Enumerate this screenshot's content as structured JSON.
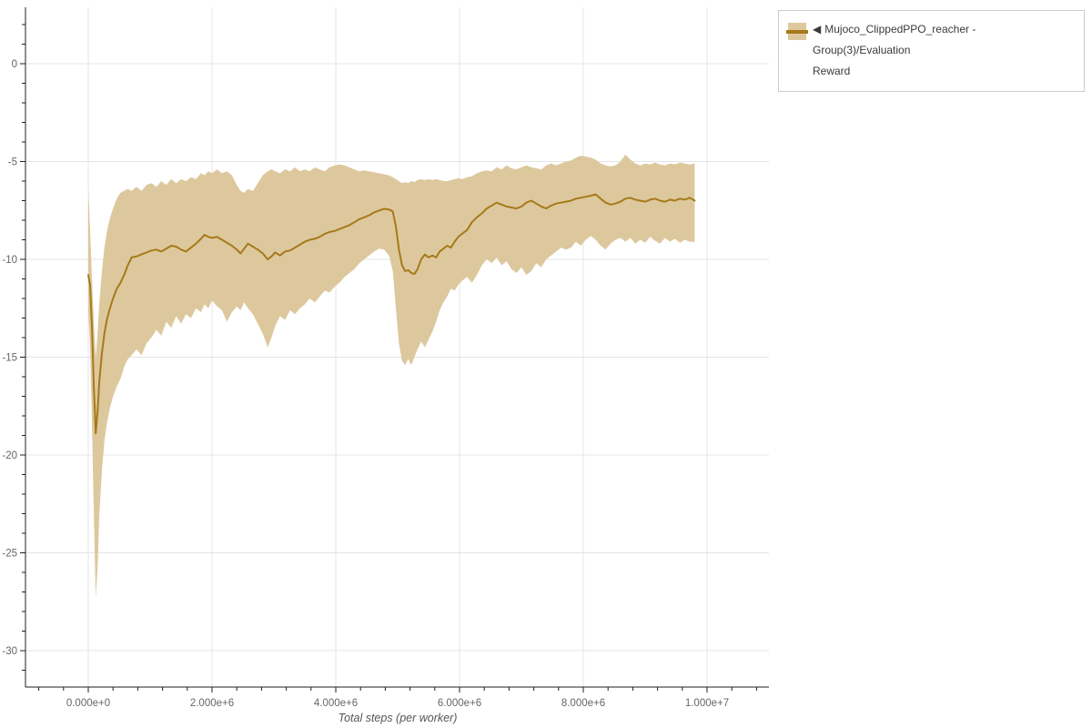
{
  "legend": {
    "marker": "◀",
    "label_line1": "Mujoco_ClippedPPO_reacher - Group(3)/Evaluation",
    "label_line2": "Reward",
    "border_color": "#cccccc",
    "text_color": "#3a3a3a"
  },
  "chart_data": {
    "type": "line",
    "title": "",
    "xlabel": "Total steps (per worker)",
    "ylabel": "",
    "grid": true,
    "legend_position": "top-right",
    "xlim_steps": [
      -1000000,
      11000000
    ],
    "ylim": [
      -31.9,
      2.9
    ],
    "colors": {
      "grid": "#e4e4e4",
      "axis": "#1f1f1f",
      "tick_label": "#666666",
      "axis_title": "#555555"
    },
    "x_axis": {
      "label": "Total steps (per worker)",
      "ticks": [
        {
          "value_millions": 0,
          "label": "0.000e+0"
        },
        {
          "value_millions": 2,
          "label": "2.000e+6"
        },
        {
          "value_millions": 4,
          "label": "4.000e+6"
        },
        {
          "value_millions": 6,
          "label": "6.000e+6"
        },
        {
          "value_millions": 8,
          "label": "8.000e+6"
        },
        {
          "value_millions": 10,
          "label": "1.000e+7"
        }
      ],
      "minor": {
        "from": -0.8,
        "to": 10.8,
        "step": 0.4
      }
    },
    "y_axis": {
      "ticks": [
        {
          "value": 0,
          "label": "0"
        },
        {
          "value": -5,
          "label": "-5"
        },
        {
          "value": -10,
          "label": "-10"
        },
        {
          "value": -15,
          "label": "-15"
        },
        {
          "value": -20,
          "label": "-20"
        },
        {
          "value": -25,
          "label": "-25"
        },
        {
          "value": -30,
          "label": "-30"
        }
      ],
      "minor": {
        "from": 2,
        "to": -31,
        "step": -1
      }
    },
    "series": [
      {
        "name": "Mujoco_ClippedPPO_reacher - Group(3)/Evaluation Reward",
        "line_color": "#a57a18",
        "band_color": "#ddc89e",
        "points_format": [
          "x_steps_millions",
          "mean",
          "band_lower",
          "band_upper"
        ],
        "points": [
          [
            0.0,
            -10.8,
            -12.6,
            -6.3
          ],
          [
            0.03,
            -11.3,
            -14.5,
            -8.5
          ],
          [
            0.06,
            -13.5,
            -18.5,
            -11.0
          ],
          [
            0.09,
            -16.5,
            -23.0,
            -13.2
          ],
          [
            0.12,
            -18.9,
            -27.3,
            -15.0
          ],
          [
            0.15,
            -17.8,
            -25.8,
            -13.8
          ],
          [
            0.18,
            -16.2,
            -23.0,
            -12.2
          ],
          [
            0.22,
            -14.8,
            -20.8,
            -10.6
          ],
          [
            0.26,
            -13.8,
            -19.3,
            -9.4
          ],
          [
            0.3,
            -13.1,
            -18.4,
            -8.6
          ],
          [
            0.35,
            -12.5,
            -17.6,
            -7.9
          ],
          [
            0.4,
            -12.0,
            -17.0,
            -7.4
          ],
          [
            0.46,
            -11.5,
            -16.5,
            -6.9
          ],
          [
            0.52,
            -11.2,
            -16.1,
            -6.6
          ],
          [
            0.58,
            -10.8,
            -15.5,
            -6.5
          ],
          [
            0.64,
            -10.3,
            -15.1,
            -6.4
          ],
          [
            0.7,
            -9.9,
            -14.9,
            -6.5
          ],
          [
            0.78,
            -9.85,
            -14.6,
            -6.3
          ],
          [
            0.86,
            -9.75,
            -14.9,
            -6.5
          ],
          [
            0.94,
            -9.65,
            -14.3,
            -6.2
          ],
          [
            1.02,
            -9.55,
            -14.0,
            -6.1
          ],
          [
            1.1,
            -9.5,
            -13.6,
            -6.3
          ],
          [
            1.18,
            -9.6,
            -13.9,
            -6.0
          ],
          [
            1.26,
            -9.45,
            -13.2,
            -6.2
          ],
          [
            1.34,
            -9.3,
            -13.5,
            -5.9
          ],
          [
            1.42,
            -9.35,
            -12.9,
            -6.1
          ],
          [
            1.5,
            -9.5,
            -13.3,
            -5.9
          ],
          [
            1.58,
            -9.6,
            -12.8,
            -6.0
          ],
          [
            1.66,
            -9.4,
            -13.0,
            -5.8
          ],
          [
            1.74,
            -9.2,
            -12.5,
            -5.9
          ],
          [
            1.82,
            -8.95,
            -12.7,
            -5.6
          ],
          [
            1.88,
            -8.75,
            -12.3,
            -5.7
          ],
          [
            1.94,
            -8.85,
            -12.5,
            -5.5
          ],
          [
            2.0,
            -8.9,
            -12.1,
            -5.6
          ],
          [
            2.08,
            -8.85,
            -12.4,
            -5.4
          ],
          [
            2.16,
            -9.0,
            -12.6,
            -5.6
          ],
          [
            2.24,
            -9.15,
            -13.2,
            -5.5
          ],
          [
            2.32,
            -9.3,
            -12.7,
            -5.7
          ],
          [
            2.4,
            -9.5,
            -12.4,
            -6.2
          ],
          [
            2.46,
            -9.7,
            -12.6,
            -6.5
          ],
          [
            2.52,
            -9.45,
            -12.2,
            -6.6
          ],
          [
            2.58,
            -9.2,
            -12.5,
            -6.4
          ],
          [
            2.66,
            -9.35,
            -12.8,
            -6.5
          ],
          [
            2.74,
            -9.5,
            -13.3,
            -6.1
          ],
          [
            2.82,
            -9.7,
            -13.8,
            -5.7
          ],
          [
            2.9,
            -10.0,
            -14.5,
            -5.5
          ],
          [
            2.96,
            -9.85,
            -14.0,
            -5.4
          ],
          [
            3.02,
            -9.65,
            -13.4,
            -5.5
          ],
          [
            3.1,
            -9.8,
            -12.9,
            -5.6
          ],
          [
            3.18,
            -9.6,
            -13.1,
            -5.4
          ],
          [
            3.26,
            -9.55,
            -12.6,
            -5.5
          ],
          [
            3.34,
            -9.4,
            -12.8,
            -5.3
          ],
          [
            3.42,
            -9.25,
            -12.5,
            -5.5
          ],
          [
            3.5,
            -9.1,
            -12.3,
            -5.4
          ],
          [
            3.58,
            -9.0,
            -12.0,
            -5.5
          ],
          [
            3.66,
            -8.95,
            -12.2,
            -5.3
          ],
          [
            3.74,
            -8.85,
            -11.9,
            -5.4
          ],
          [
            3.82,
            -8.7,
            -11.6,
            -5.5
          ],
          [
            3.9,
            -8.6,
            -11.7,
            -5.3
          ],
          [
            3.98,
            -8.55,
            -11.4,
            -5.2
          ],
          [
            4.06,
            -8.45,
            -11.2,
            -5.15
          ],
          [
            4.14,
            -8.35,
            -10.9,
            -5.2
          ],
          [
            4.22,
            -8.25,
            -10.7,
            -5.3
          ],
          [
            4.3,
            -8.1,
            -10.5,
            -5.4
          ],
          [
            4.38,
            -7.95,
            -10.2,
            -5.5
          ],
          [
            4.46,
            -7.85,
            -10.0,
            -5.45
          ],
          [
            4.54,
            -7.75,
            -9.8,
            -5.5
          ],
          [
            4.62,
            -7.6,
            -9.6,
            -5.55
          ],
          [
            4.7,
            -7.5,
            -9.45,
            -5.6
          ],
          [
            4.78,
            -7.42,
            -9.5,
            -5.65
          ],
          [
            4.86,
            -7.45,
            -9.8,
            -5.7
          ],
          [
            4.92,
            -7.55,
            -10.6,
            -5.8
          ],
          [
            4.97,
            -8.3,
            -12.5,
            -5.9
          ],
          [
            5.02,
            -9.5,
            -14.3,
            -6.0
          ],
          [
            5.07,
            -10.3,
            -15.2,
            -6.1
          ],
          [
            5.12,
            -10.6,
            -15.4,
            -6.05
          ],
          [
            5.17,
            -10.55,
            -15.1,
            -6.1
          ],
          [
            5.22,
            -10.7,
            -15.4,
            -6.0
          ],
          [
            5.27,
            -10.75,
            -15.0,
            -6.05
          ],
          [
            5.32,
            -10.5,
            -14.6,
            -5.95
          ],
          [
            5.38,
            -10.0,
            -14.2,
            -5.9
          ],
          [
            5.44,
            -9.75,
            -14.5,
            -5.95
          ],
          [
            5.5,
            -9.9,
            -14.1,
            -5.9
          ],
          [
            5.56,
            -9.8,
            -13.7,
            -5.95
          ],
          [
            5.62,
            -9.9,
            -13.2,
            -5.9
          ],
          [
            5.68,
            -9.6,
            -12.6,
            -5.95
          ],
          [
            5.74,
            -9.45,
            -12.2,
            -6.0
          ],
          [
            5.8,
            -9.3,
            -11.9,
            -6.0
          ],
          [
            5.86,
            -9.4,
            -11.5,
            -5.95
          ],
          [
            5.92,
            -9.1,
            -11.6,
            -5.9
          ],
          [
            5.98,
            -8.85,
            -11.3,
            -5.85
          ],
          [
            6.04,
            -8.7,
            -11.1,
            -5.9
          ],
          [
            6.12,
            -8.5,
            -10.9,
            -5.8
          ],
          [
            6.2,
            -8.1,
            -11.2,
            -5.75
          ],
          [
            6.28,
            -7.85,
            -10.8,
            -5.6
          ],
          [
            6.36,
            -7.65,
            -10.3,
            -5.5
          ],
          [
            6.44,
            -7.4,
            -10.0,
            -5.45
          ],
          [
            6.52,
            -7.25,
            -10.2,
            -5.5
          ],
          [
            6.6,
            -7.1,
            -9.9,
            -5.3
          ],
          [
            6.68,
            -7.2,
            -10.3,
            -5.4
          ],
          [
            6.76,
            -7.3,
            -10.1,
            -5.2
          ],
          [
            6.84,
            -7.35,
            -10.5,
            -5.35
          ],
          [
            6.92,
            -7.4,
            -10.7,
            -5.4
          ],
          [
            7.0,
            -7.3,
            -10.4,
            -5.3
          ],
          [
            7.08,
            -7.1,
            -10.8,
            -5.2
          ],
          [
            7.16,
            -7.0,
            -10.6,
            -5.3
          ],
          [
            7.24,
            -7.15,
            -10.2,
            -5.35
          ],
          [
            7.32,
            -7.3,
            -10.4,
            -5.4
          ],
          [
            7.4,
            -7.4,
            -10.0,
            -5.2
          ],
          [
            7.48,
            -7.25,
            -9.8,
            -5.1
          ],
          [
            7.56,
            -7.15,
            -9.6,
            -5.2
          ],
          [
            7.64,
            -7.1,
            -9.4,
            -5.1
          ],
          [
            7.72,
            -7.05,
            -9.5,
            -5.0
          ],
          [
            7.8,
            -7.0,
            -9.4,
            -4.95
          ],
          [
            7.88,
            -6.9,
            -9.1,
            -4.8
          ],
          [
            7.96,
            -6.85,
            -9.3,
            -4.7
          ],
          [
            8.04,
            -6.8,
            -9.0,
            -4.75
          ],
          [
            8.12,
            -6.75,
            -8.8,
            -4.8
          ],
          [
            8.2,
            -6.68,
            -9.0,
            -4.9
          ],
          [
            8.28,
            -6.9,
            -9.3,
            -5.1
          ],
          [
            8.36,
            -7.1,
            -9.5,
            -5.2
          ],
          [
            8.44,
            -7.2,
            -9.2,
            -5.25
          ],
          [
            8.52,
            -7.15,
            -9.0,
            -5.2
          ],
          [
            8.6,
            -7.05,
            -8.9,
            -5.0
          ],
          [
            8.68,
            -6.9,
            -9.1,
            -4.65
          ],
          [
            8.76,
            -6.85,
            -8.9,
            -4.9
          ],
          [
            8.84,
            -6.95,
            -9.2,
            -5.1
          ],
          [
            8.92,
            -7.0,
            -9.0,
            -5.2
          ],
          [
            9.0,
            -7.05,
            -9.15,
            -5.1
          ],
          [
            9.08,
            -6.95,
            -8.85,
            -5.15
          ],
          [
            9.16,
            -6.9,
            -9.05,
            -5.05
          ],
          [
            9.24,
            -7.0,
            -9.2,
            -5.15
          ],
          [
            9.32,
            -7.05,
            -8.9,
            -5.2
          ],
          [
            9.4,
            -6.95,
            -9.1,
            -5.1
          ],
          [
            9.48,
            -7.0,
            -8.95,
            -5.15
          ],
          [
            9.56,
            -6.9,
            -9.15,
            -5.05
          ],
          [
            9.64,
            -6.95,
            -9.0,
            -5.1
          ],
          [
            9.72,
            -6.85,
            -9.1,
            -5.15
          ],
          [
            9.8,
            -7.0,
            -9.1,
            -5.1
          ]
        ]
      }
    ]
  }
}
